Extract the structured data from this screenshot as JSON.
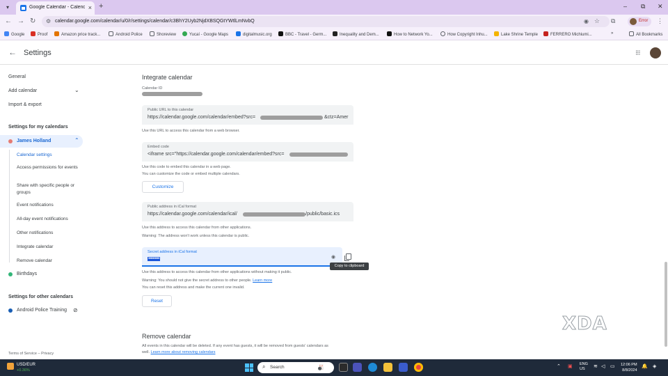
{
  "browser": {
    "tab_title": "Google Calendar - Calendar se",
    "url": "calendar.google.com/calendar/u/0/r/settings/calendar/c3BhY2Uyb2NjdXBSQGtYWtlLmNvbQ",
    "profile_label": "Error",
    "bookmarks": [
      "Google",
      "Proof",
      "Amazon price track...",
      "Android Police",
      "Shoreview",
      "Yucaí - Google Maps",
      "digitalmusic.org",
      "BBC - Travel - Germ...",
      "Inequality and Dem...",
      "How to Network Yo...",
      "How Copyright Inhu...",
      "Lake Shrine Temple",
      "FERRERO Michiumi...",
      "All Bookmarks"
    ]
  },
  "header": {
    "title": "Settings"
  },
  "sidebar": {
    "general": "General",
    "add_calendar": "Add calendar",
    "import_export": "Import & export",
    "my_calendars_heading": "Settings for my calendars",
    "calendar_name": "James Holland",
    "sub_items": [
      "Calendar settings",
      "Access permissions for events",
      "Share with specific people or groups",
      "Event notifications",
      "All-day event notifications",
      "Other notifications",
      "Integrate calendar",
      "Remove calendar"
    ],
    "birthdays": "Birthdays",
    "other_calendars_heading": "Settings for other calendars",
    "other_calendar": "Android Police Training",
    "footer": "Terms of Service – Privacy",
    "colors": {
      "james": "#e67c73",
      "birthdays": "#33b679",
      "other": "#1a5fb4"
    }
  },
  "main": {
    "integrate_title": "Integrate calendar",
    "calendar_id_label": "Calendar ID",
    "public_url": {
      "label": "Public URL to this calendar",
      "value_start": "https://calendar.google.com/calendar/embed?src=",
      "value_end": "&ctz=Amer",
      "help": "Use this URL to access this calendar from a web browser."
    },
    "embed": {
      "label": "Embed code",
      "value_start": "<iframe src=\"https://calendar.google.com/calendar/embed?src=",
      "help1": "Use this code to embed this calendar in a web page.",
      "help2": "You can customize the code or embed multiple calendars."
    },
    "customize_button": "Customize",
    "ical_public": {
      "label": "Public address in iCal format",
      "value_start": "https://calendar.google.com/calendar/ical/",
      "value_end": "/public/basic.ics",
      "help1": "Use this address to access this calendar from other applications.",
      "help2": "Warning: The address won't work unless this calendar is public."
    },
    "ical_secret": {
      "label": "Secret address in iCal format",
      "value": "••••••••••",
      "help1": "Use this address to access this calendar from other applications without making it public.",
      "help2": "Warning: You should not give the secret address to other people.",
      "learn_more": "Learn more",
      "help3": "You can reset this address and make the current one invalid."
    },
    "tooltip": "Copy to clipboard",
    "reset_button": "Reset",
    "remove_title": "Remove calendar",
    "remove_help1": "All events in this calendar will be deleted. If any event has guests, it will be removed from guests' calendars as",
    "remove_help2_prefix": "well.",
    "remove_link": "Learn more about removing calendars"
  },
  "watermark": "XDA",
  "taskbar": {
    "ticker": "USD/EUR",
    "ticker_change": "+0.36%",
    "search_placeholder": "Search",
    "lang1": "ENG",
    "lang2": "US",
    "time": "12:06 PM",
    "date": "8/8/2024"
  }
}
